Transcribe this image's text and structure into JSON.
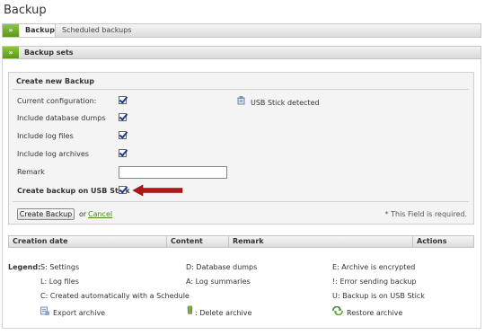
{
  "page": {
    "title": "Backup"
  },
  "tabs": [
    {
      "label": "Backup",
      "active": true
    },
    {
      "label": "Scheduled backups",
      "active": false
    }
  ],
  "tab_marker": "»",
  "section": {
    "marker": "»",
    "title": "Backup sets"
  },
  "form": {
    "title": "Create new Backup",
    "fields": [
      {
        "label": "Current configuration:",
        "checked": true
      },
      {
        "label": "Include database dumps",
        "checked": true
      },
      {
        "label": "Include log files",
        "checked": true
      },
      {
        "label": "Include log archives",
        "checked": true
      }
    ],
    "usb_status": "USB Stick detected",
    "remark_label": "Remark",
    "remark_value": "",
    "usb_backup_label": "Create backup on USB Stick",
    "usb_backup_checked": true,
    "create_button": "Create Backup",
    "or_text": "or",
    "cancel_link": "Cancel",
    "required_note": "* This Field is required."
  },
  "table": {
    "columns": [
      "Creation date",
      "Content",
      "Remark",
      "Actions"
    ]
  },
  "legend": {
    "title": "Legend:",
    "items": [
      "S: Settings",
      "D: Database dumps",
      "E: Archive is encrypted",
      "L: Log files",
      "A: Log summaries",
      "!: Error sending backup",
      "C: Created automatically with a Schedule",
      "U: Backup is on USB Stick"
    ],
    "actions": [
      {
        "label": "Export archive",
        "icon": "export-icon"
      },
      {
        "label": ": Delete archive",
        "icon": "trash-icon"
      },
      {
        "label": "Restore archive",
        "icon": "restore-icon"
      }
    ]
  },
  "colors": {
    "accent_green": "#6aaa22",
    "arrow_red": "#b01818",
    "link_green": "#4a8a12"
  }
}
